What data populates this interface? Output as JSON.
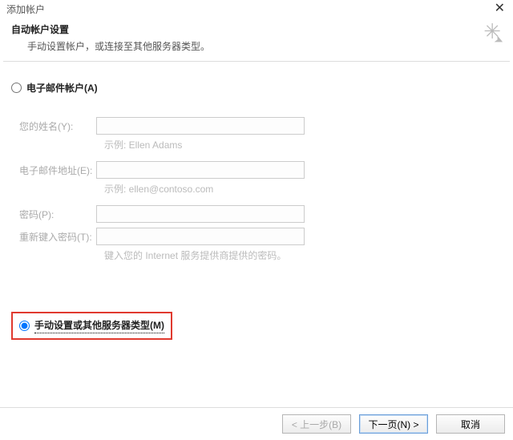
{
  "window": {
    "title": "添加帐户"
  },
  "header": {
    "title": "自动帐户设置",
    "subtitle": "手动设置帐户，或连接至其他服务器类型。"
  },
  "options": {
    "email_account_label": "电子邮件帐户(A)",
    "manual_label": "手动设置或其他服务器类型(M)"
  },
  "form": {
    "name_label": "您的姓名(Y):",
    "name_hint": "示例: Ellen Adams",
    "email_label": "电子邮件地址(E):",
    "email_hint": "示例: ellen@contoso.com",
    "password_label": "密码(P):",
    "retype_label": "重新键入密码(T):",
    "password_hint": "键入您的 Internet 服务提供商提供的密码。"
  },
  "footer": {
    "back": "< 上一步(B)",
    "next": "下一页(N) >",
    "cancel": "取消"
  }
}
